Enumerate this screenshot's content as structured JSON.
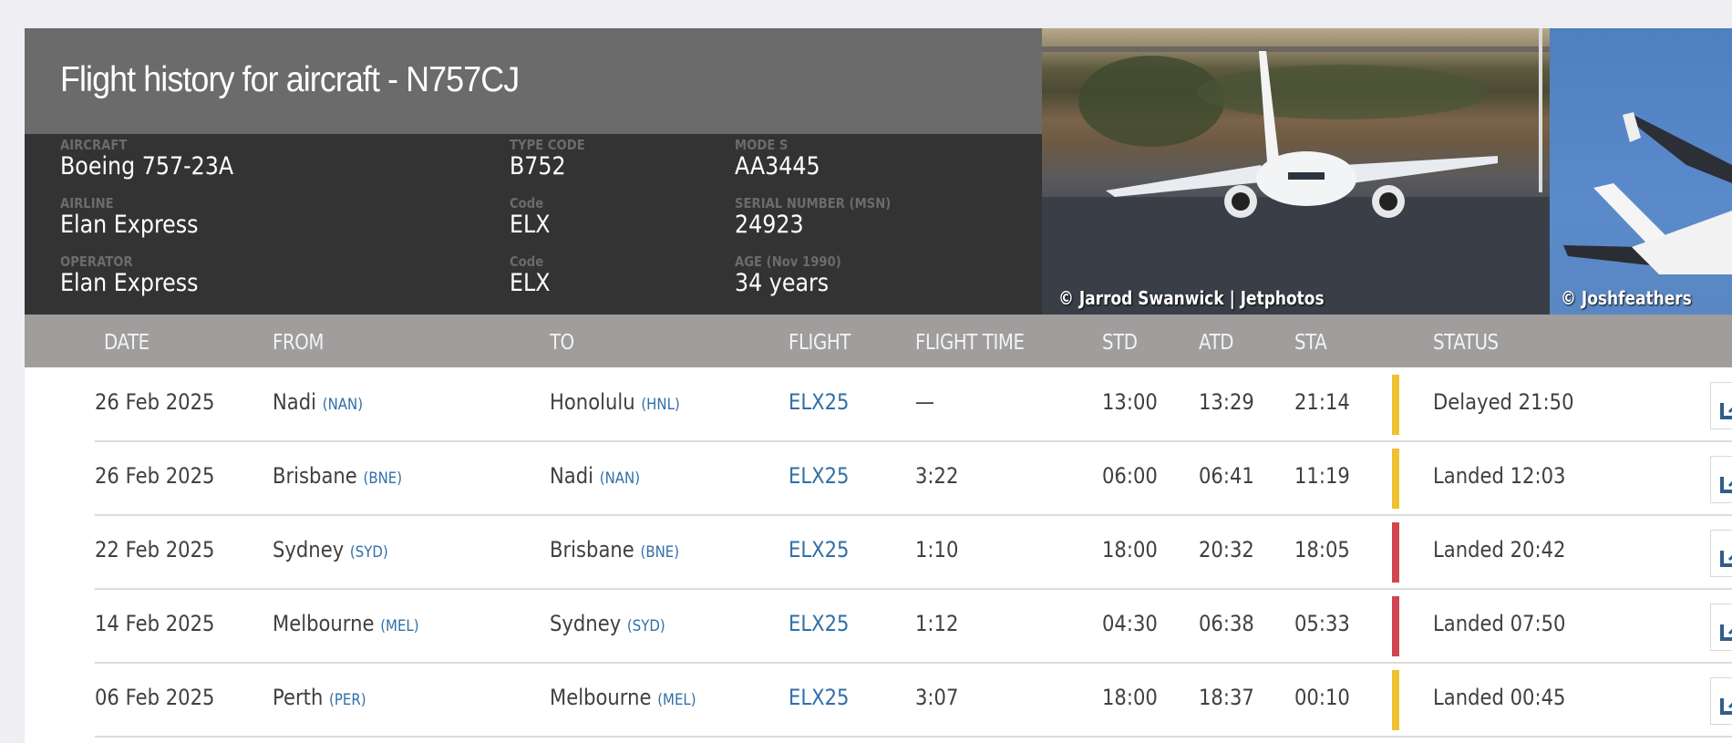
{
  "header": {
    "title": "Flight history for aircraft - N757CJ"
  },
  "aircraft_info": {
    "columns": [
      {
        "fields": [
          {
            "label": "AIRCRAFT",
            "value": "Boeing 757-23A"
          },
          {
            "label": "AIRLINE",
            "value": "Elan Express"
          },
          {
            "label": "OPERATOR",
            "value": "Elan Express"
          }
        ]
      },
      {
        "fields": [
          {
            "label": "TYPE CODE",
            "value": "B752"
          },
          {
            "label": "Code",
            "value": "ELX"
          },
          {
            "label": "Code",
            "value": "ELX"
          }
        ]
      },
      {
        "fields": [
          {
            "label": "MODE S",
            "value": "AA3445"
          },
          {
            "label": "SERIAL NUMBER (MSN)",
            "value": "24923"
          },
          {
            "label": "AGE (Nov 1990)",
            "value": "34 years"
          }
        ]
      }
    ]
  },
  "photos": [
    {
      "credit": "© Jarrod Swanwick | Jetphotos"
    },
    {
      "credit": "© Joshfeathers"
    }
  ],
  "table": {
    "headers": [
      "DATE",
      "FROM",
      "TO",
      "FLIGHT",
      "FLIGHT TIME",
      "STD",
      "ATD",
      "STA",
      "STATUS"
    ],
    "rows": [
      {
        "date": "26 Feb 2025",
        "from_city": "Nadi",
        "from_code": "(NAN)",
        "to_city": "Honolulu",
        "to_code": "(HNL)",
        "flight": "ELX25",
        "flight_time": "—",
        "std": "13:00",
        "atd": "13:29",
        "sta": "21:14",
        "status_color": "#f0c030",
        "status": "Delayed 21:50"
      },
      {
        "date": "26 Feb 2025",
        "from_city": "Brisbane",
        "from_code": "(BNE)",
        "to_city": "Nadi",
        "to_code": "(NAN)",
        "flight": "ELX25",
        "flight_time": "3:22",
        "std": "06:00",
        "atd": "06:41",
        "sta": "11:19",
        "status_color": "#f0c030",
        "status": "Landed 12:03"
      },
      {
        "date": "22 Feb 2025",
        "from_city": "Sydney",
        "from_code": "(SYD)",
        "to_city": "Brisbane",
        "to_code": "(BNE)",
        "flight": "ELX25",
        "flight_time": "1:10",
        "std": "18:00",
        "atd": "20:32",
        "sta": "18:05",
        "status_color": "#d0454f",
        "status": "Landed 20:42"
      },
      {
        "date": "14 Feb 2025",
        "from_city": "Melbourne",
        "from_code": "(MEL)",
        "to_city": "Sydney",
        "to_code": "(SYD)",
        "flight": "ELX25",
        "flight_time": "1:12",
        "std": "04:30",
        "atd": "06:38",
        "sta": "05:33",
        "status_color": "#d0454f",
        "status": "Landed 07:50"
      },
      {
        "date": "06 Feb 2025",
        "from_city": "Perth",
        "from_code": "(PER)",
        "to_city": "Melbourne",
        "to_code": "(MEL)",
        "flight": "ELX25",
        "flight_time": "3:07",
        "std": "18:00",
        "atd": "18:37",
        "sta": "00:10",
        "status_color": "#f0c030",
        "status": "Landed 00:45"
      }
    ],
    "row_action_icon": "flight-playback-icon"
  }
}
